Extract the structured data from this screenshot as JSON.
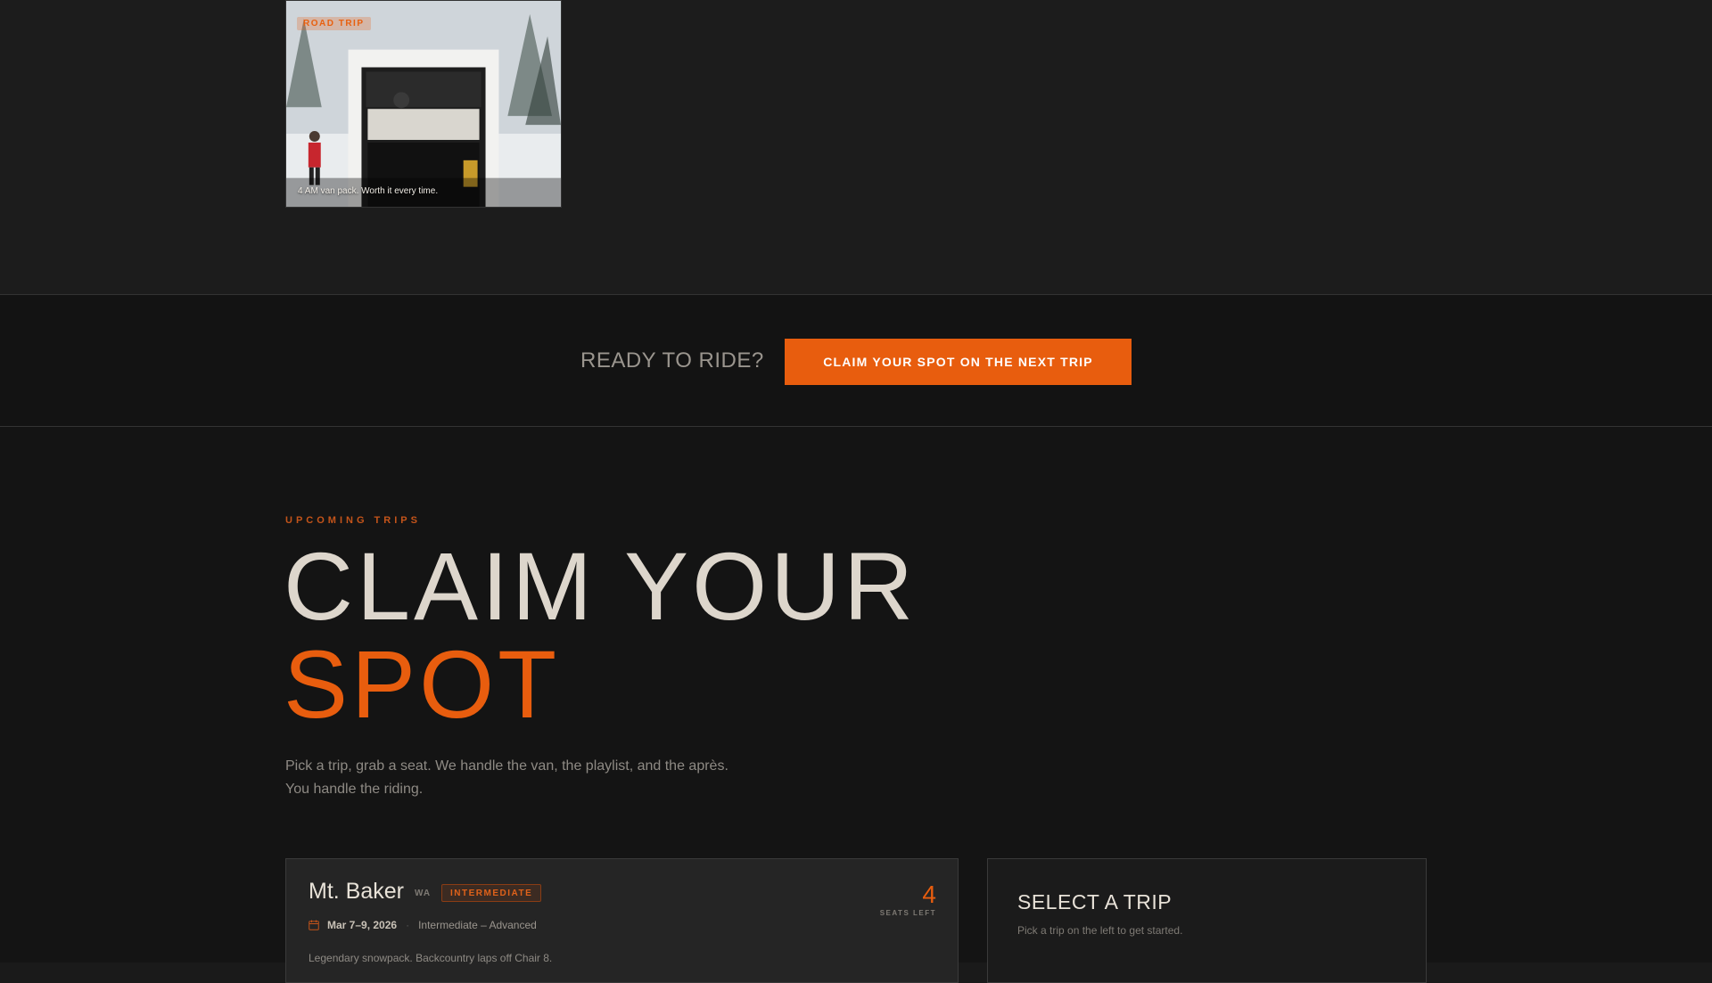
{
  "gallery": {
    "photo": {
      "tag": "ROAD TRIP",
      "caption": "4 AM van pack. Worth it every time."
    }
  },
  "cta": {
    "text": "READY TO RIDE?",
    "button_label": "CLAIM YOUR SPOT ON THE NEXT TRIP"
  },
  "trips": {
    "eyebrow": "UPCOMING TRIPS",
    "headline_line1": "CLAIM YOUR",
    "headline_line2": "SPOT",
    "lead_line1": "Pick a trip, grab a seat. We handle the van, the playlist, and the après.",
    "lead_line2": "You handle the riding.",
    "cards": [
      {
        "name": "Mt. Baker",
        "state": "WA",
        "level": "INTERMEDIATE",
        "dates": "Mar 7–9, 2026",
        "skill": "Intermediate – Advanced",
        "description": "Legendary snowpack. Backcountry laps off Chair 8.",
        "seats": "4",
        "seats_label": "SEATS LEFT",
        "icon": "calendar-icon"
      }
    ],
    "select_panel": {
      "title": "SELECT A TRIP",
      "subtitle": "Pick a trip on the left to get started."
    }
  },
  "colors": {
    "accent": "#e85d0e",
    "background": "#1a1a1a",
    "text": "#ddd6cc"
  }
}
